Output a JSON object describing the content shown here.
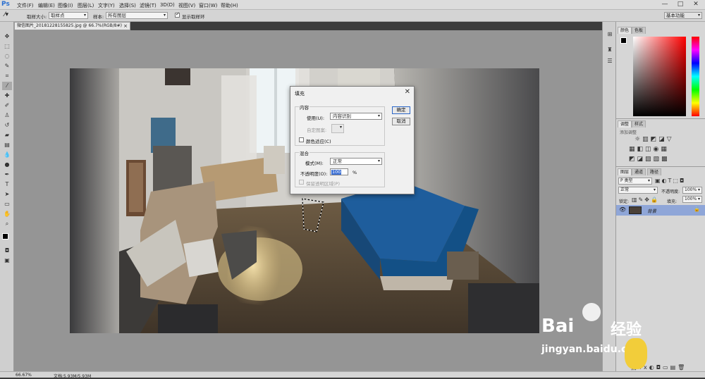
{
  "app": {
    "logo": "Ps",
    "workspace_preset": "基本功能"
  },
  "menu": [
    "文件(F)",
    "编辑(E)",
    "图像(I)",
    "图层(L)",
    "文字(Y)",
    "选择(S)",
    "滤镜(T)",
    "3D(D)",
    "视图(V)",
    "窗口(W)",
    "帮助(H)"
  ],
  "window_controls": {
    "minimize": "—",
    "restore": "□",
    "close": "✕"
  },
  "options_bar": {
    "sample_size_label": "取样大小:",
    "sample_size_value": "取样点",
    "sample_label": "样本:",
    "sample_value": "所有图层",
    "show_ring_label": "显示取样环"
  },
  "document": {
    "tab_title": "微信图片_20181228155825.jpg @ 66.7%(RGB/8#)"
  },
  "status": {
    "zoom": "66.67%",
    "doc_info": "文档:5.93M/5.93M"
  },
  "panels": {
    "color_tabs": [
      "颜色",
      "色板"
    ],
    "adjust_tabs": [
      "调整",
      "样式"
    ],
    "adjust_hint": "添加调整",
    "layers_tabs": [
      "图层",
      "通道",
      "路径"
    ],
    "kind_label": "P 类型",
    "blend_mode": "正常",
    "opacity_label": "不透明度:",
    "opacity_value": "100%",
    "lock_label": "锁定:",
    "fill_label": "填充:",
    "fill_value": "100%",
    "layer_name": "背景"
  },
  "dialog": {
    "title": "填充",
    "content_group": "内容",
    "use_label": "使用(U):",
    "use_value": "内容识别",
    "custom_pattern_label": "自定图案:",
    "color_adapt_label": "颜色适应(C)",
    "blend_group": "混合",
    "mode_label": "模式(M):",
    "mode_value": "正常",
    "opacity_label": "不透明度(O):",
    "opacity_value": "100",
    "opacity_unit": "%",
    "preserve_label": "保留透明区域(P)",
    "ok": "确定",
    "cancel": "取消"
  },
  "watermark": {
    "brand": "Bai",
    "brand2": "经验",
    "url": "jingyan.baidu.com"
  }
}
